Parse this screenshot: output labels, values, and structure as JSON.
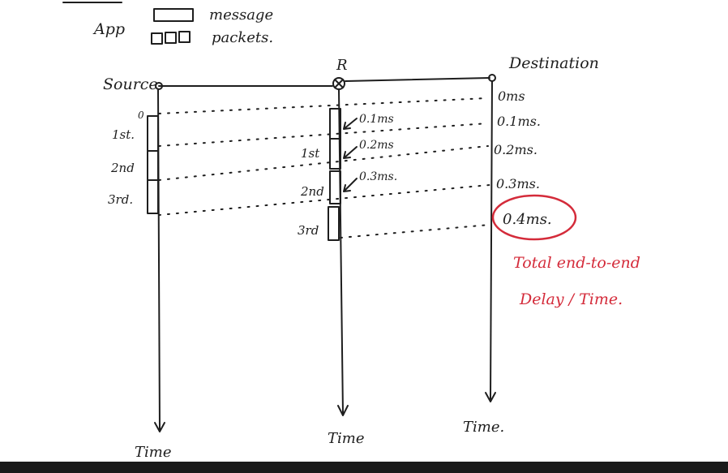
{
  "legend": {
    "app": "App",
    "message": "message",
    "packets": "packets."
  },
  "nodes": {
    "source": "Source",
    "router": "R",
    "destination": "Destination"
  },
  "source_marks": [
    "0",
    "1st.",
    "2nd",
    "3rd."
  ],
  "router_marks": [
    "1st",
    "2nd",
    "3rd"
  ],
  "router_delays": [
    "0.1ms",
    "0.2ms",
    "0.3ms."
  ],
  "destination_times": [
    "0ms",
    "0.1ms.",
    "0.2ms.",
    "0.3ms.",
    "0.4ms."
  ],
  "annotation": {
    "line1": "Total end-to-end",
    "line2": "Delay / Time."
  },
  "time_labels": {
    "source": "Time",
    "router": "Time",
    "destination": "Time."
  },
  "colors": {
    "ink": "#1e1e1e",
    "annotation_red": "#d42b3a",
    "bottom_bar": "#1a1a1a"
  }
}
